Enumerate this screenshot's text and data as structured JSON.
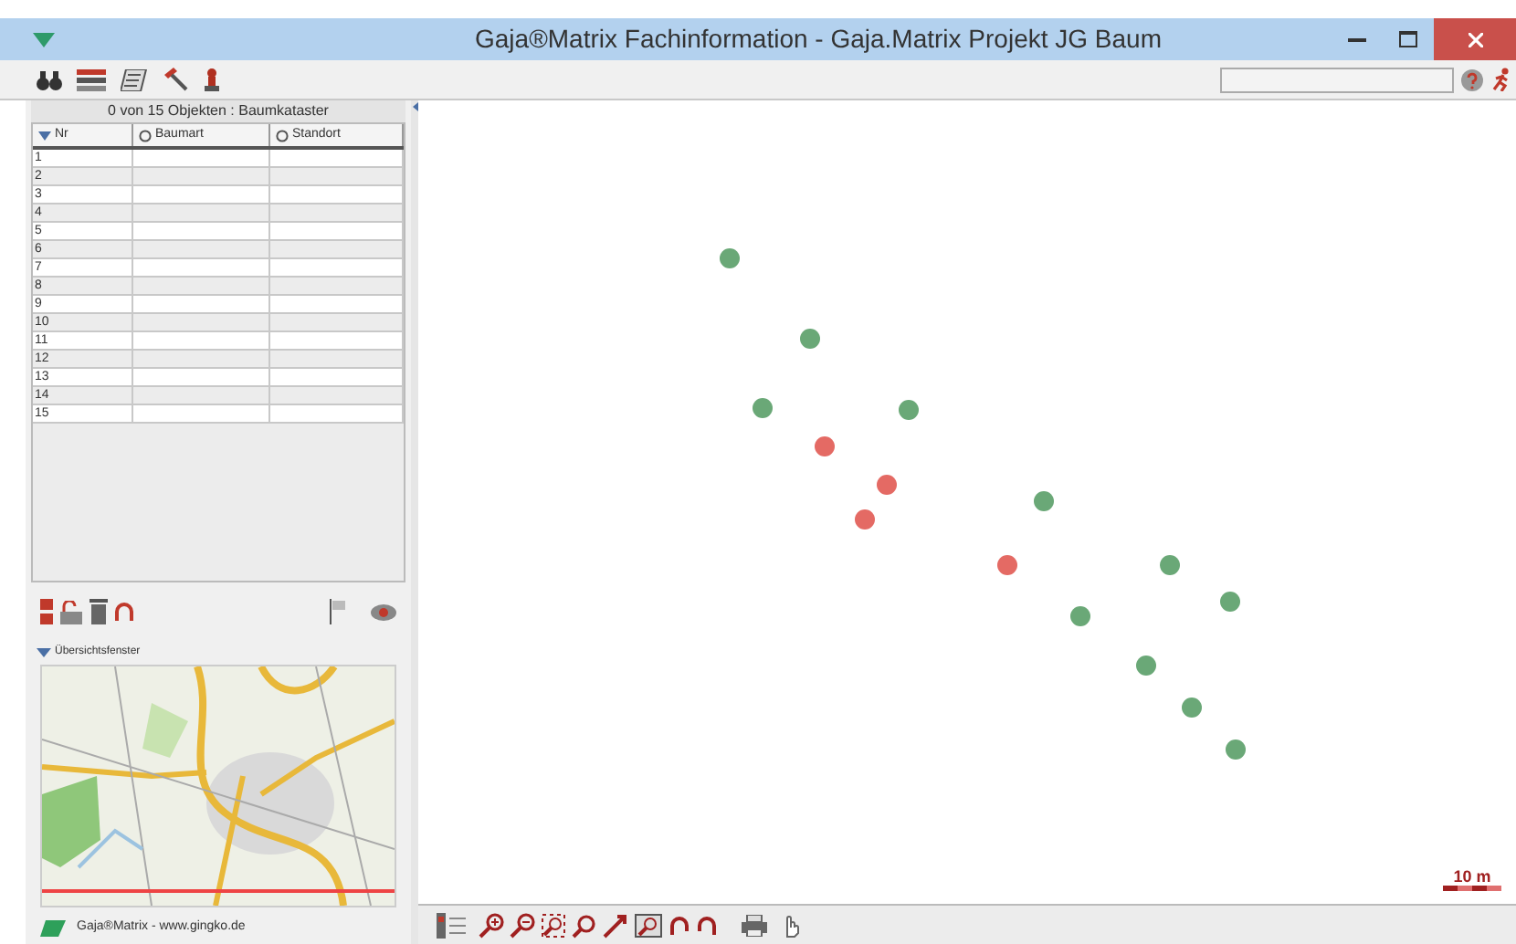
{
  "window": {
    "title": "Gaja®Matrix Fachinformation - Gaja.Matrix Projekt JG Baum"
  },
  "table": {
    "caption": "0 von 15 Objekten : Baumkataster",
    "columns": [
      {
        "label": "Nr",
        "sorted": true
      },
      {
        "label": "Baumart",
        "sorted": false
      },
      {
        "label": "Standort",
        "sorted": false
      }
    ],
    "rows": [
      [
        "1"
      ],
      [
        "2"
      ],
      [
        "3"
      ],
      [
        "4"
      ],
      [
        "5"
      ],
      [
        "6"
      ],
      [
        "7"
      ],
      [
        "8"
      ],
      [
        "9"
      ],
      [
        "10"
      ],
      [
        "11"
      ],
      [
        "12"
      ],
      [
        "13"
      ],
      [
        "14"
      ],
      [
        "15"
      ]
    ]
  },
  "overview": {
    "title": "Übersichtsfenster",
    "expanded": true
  },
  "footer": {
    "text": "Gaja®Matrix - www.gingko.de"
  },
  "map": {
    "scale": "10 m",
    "points": [
      {
        "color": "#6aa877"
      },
      {
        "color": "#6aa877"
      },
      {
        "color": "#6aa877"
      },
      {
        "color": "#6aa877"
      },
      {
        "color": "#e46a64"
      },
      {
        "color": "#e46a64"
      },
      {
        "color": "#6aa877"
      },
      {
        "color": "#e46a64"
      },
      {
        "color": "#6aa877"
      },
      {
        "color": "#e46a64"
      },
      {
        "color": "#6aa877"
      },
      {
        "color": "#6aa877"
      },
      {
        "color": "#6aa877"
      },
      {
        "color": "#6aa877"
      },
      {
        "color": "#6aa877"
      }
    ]
  }
}
